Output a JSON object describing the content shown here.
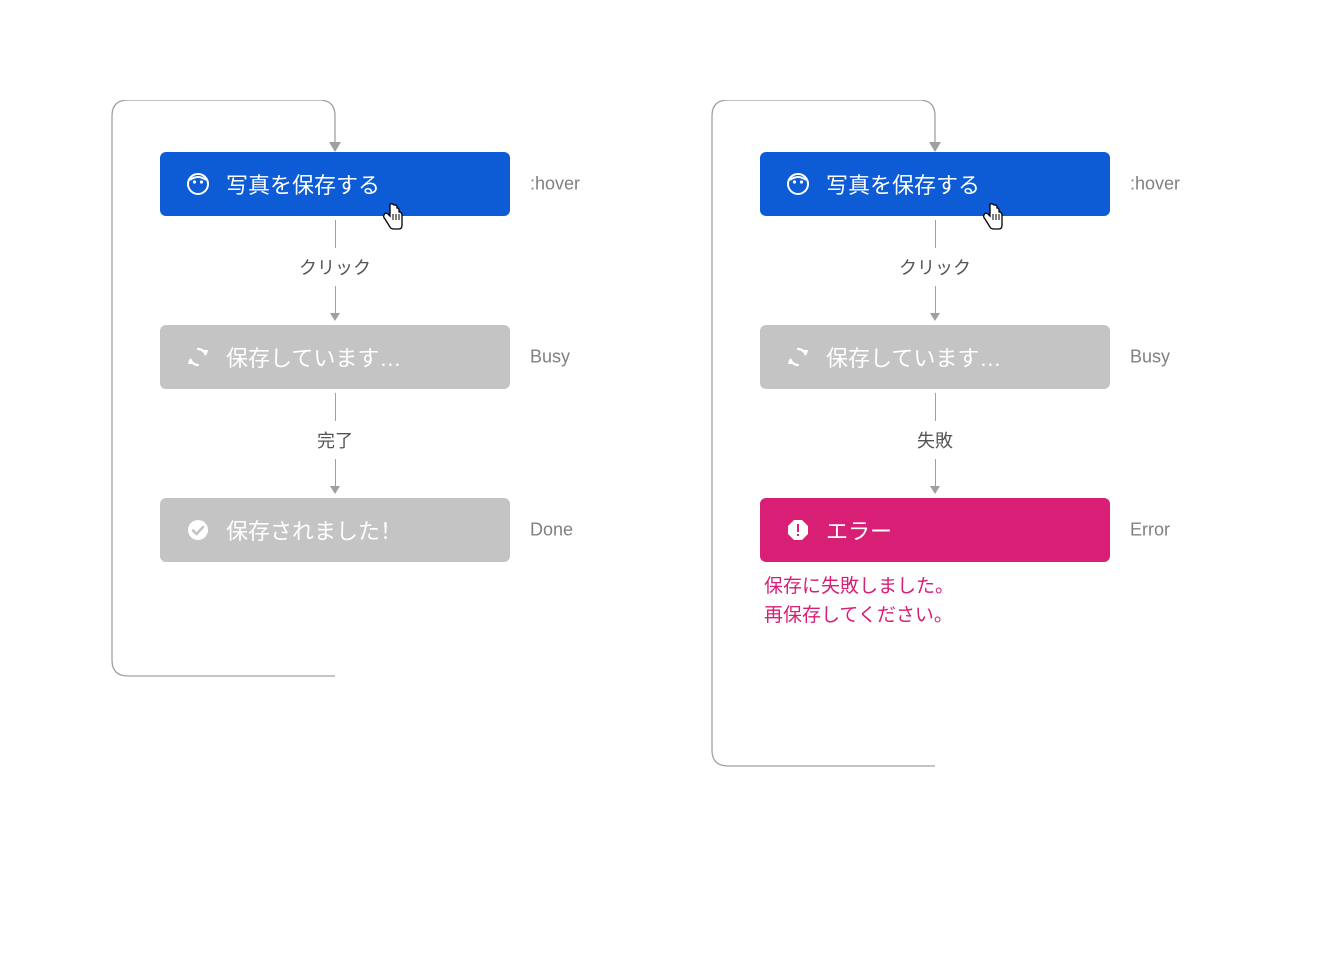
{
  "flows": {
    "success": {
      "hover": {
        "label": "写真を保存する",
        "side": ":hover"
      },
      "connector1": "クリック",
      "busy": {
        "label": "保存しています…",
        "side": "Busy"
      },
      "connector2": "完了",
      "done": {
        "label": "保存されました！",
        "side": "Done"
      }
    },
    "failure": {
      "hover": {
        "label": "写真を保存する",
        "side": ":hover"
      },
      "connector1": "クリック",
      "busy": {
        "label": "保存しています…",
        "side": "Busy"
      },
      "connector2": "失敗",
      "error": {
        "label": "エラー",
        "side": "Error"
      },
      "error_message_line1": "保存に失敗しました。",
      "error_message_line2": "再保存してください。"
    }
  },
  "colors": {
    "blue": "#0d5bd5",
    "gray": "#c4c4c4",
    "pink": "#d81e75",
    "muted": "#808080"
  }
}
